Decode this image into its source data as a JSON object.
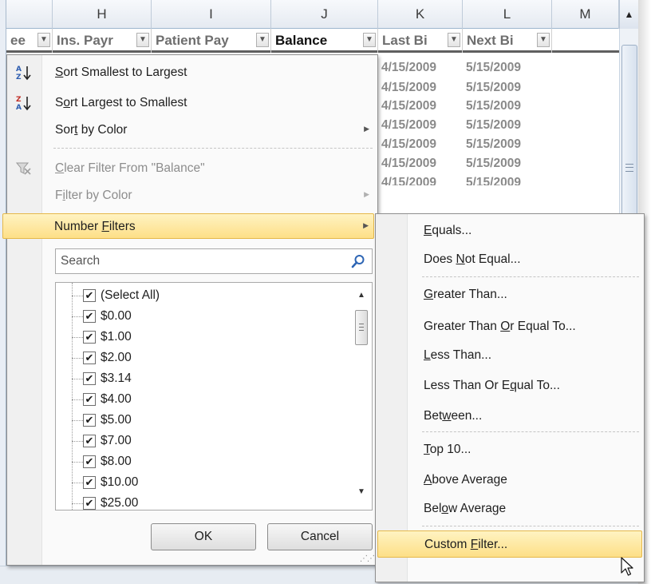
{
  "sheet": {
    "column_letters": [
      "H",
      "I",
      "J",
      "K",
      "L",
      "M"
    ],
    "filter_headers": {
      "partial_left": "ee",
      "ins_payer": "Ins. Payr",
      "patient_pay": "Patient Pay",
      "balance": "Balance",
      "last_bill": "Last Bi",
      "next_bill": "Next Bi"
    },
    "date_rows": [
      {
        "last": "4/15/2009",
        "next": "5/15/2009"
      },
      {
        "last": "4/15/2009",
        "next": "5/15/2009"
      },
      {
        "last": "4/15/2009",
        "next": "5/15/2009"
      },
      {
        "last": "4/15/2009",
        "next": "5/15/2009"
      },
      {
        "last": "4/15/2009",
        "next": "5/15/2009"
      },
      {
        "last": "4/15/2009",
        "next": "5/15/2009"
      },
      {
        "last": "4/15/2009",
        "next": "5/15/2009"
      }
    ]
  },
  "filter_menu": {
    "sort_smallest": {
      "pre": "",
      "u": "S",
      "post": "ort Smallest to Largest"
    },
    "sort_largest": {
      "pre": "S",
      "u": "o",
      "post": "rt Largest to Smallest"
    },
    "sort_by_color": {
      "pre": "Sor",
      "u": "t",
      "post": " by Color"
    },
    "clear_filter": {
      "pre": "",
      "u": "C",
      "post": "lear Filter From \"Balance\""
    },
    "filter_by_color": {
      "pre": "F",
      "u": "i",
      "post": "lter by Color"
    },
    "number_filters": {
      "pre": "Number ",
      "u": "F",
      "post": "ilters"
    },
    "search_placeholder": "Search",
    "values": [
      {
        "label": "(Select All)",
        "checked": true
      },
      {
        "label": "$0.00",
        "checked": true
      },
      {
        "label": "$1.00",
        "checked": true
      },
      {
        "label": "$2.00",
        "checked": true
      },
      {
        "label": "$3.14",
        "checked": true
      },
      {
        "label": "$4.00",
        "checked": true
      },
      {
        "label": "$5.00",
        "checked": true
      },
      {
        "label": "$7.00",
        "checked": true
      },
      {
        "label": "$8.00",
        "checked": true
      },
      {
        "label": "$10.00",
        "checked": true
      },
      {
        "label": "$25.00",
        "checked": true
      }
    ],
    "ok_label": "OK",
    "cancel_label": "Cancel"
  },
  "number_submenu": {
    "equals": {
      "pre": "",
      "u": "E",
      "post": "quals..."
    },
    "does_not_equal": {
      "pre": "Does ",
      "u": "N",
      "post": "ot Equal..."
    },
    "greater_than": {
      "pre": "",
      "u": "G",
      "post": "reater Than..."
    },
    "greater_or_equal": {
      "pre": "Greater Than ",
      "u": "O",
      "post": "r Equal To..."
    },
    "less_than": {
      "pre": "",
      "u": "L",
      "post": "ess Than..."
    },
    "less_or_equal": {
      "pre": "Less Than Or E",
      "u": "q",
      "post": "ual To..."
    },
    "between": {
      "pre": "Bet",
      "u": "w",
      "post": "een..."
    },
    "top_10": {
      "pre": "",
      "u": "T",
      "post": "op 10..."
    },
    "above_average": {
      "pre": "",
      "u": "A",
      "post": "bove Average"
    },
    "below_average": {
      "pre": "Bel",
      "u": "o",
      "post": "w Average"
    },
    "custom_filter": {
      "pre": "Custom ",
      "u": "F",
      "post": "ilter..."
    }
  },
  "icons": {
    "sort_asc": "sort-ascending-icon",
    "sort_desc": "sort-descending-icon",
    "clear_filter": "clear-filter-icon",
    "search": "search-icon",
    "submenu_arrow": "submenu-arrow-icon",
    "dropdown": "dropdown-arrow-icon",
    "cursor": "mouse-pointer-icon"
  },
  "colors": {
    "highlight_top": "#fff3c2",
    "highlight_bottom": "#fddf87",
    "highlight_border": "#e5b84a",
    "header_bg": "#e5eaf1",
    "disabled_text": "#8d8d8d"
  }
}
